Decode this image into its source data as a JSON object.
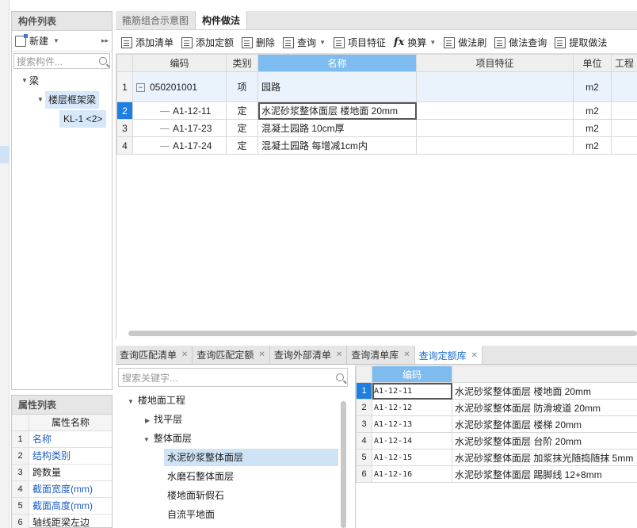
{
  "component_panel": {
    "title": "构件列表",
    "new_label": "新建",
    "search_placeholder": "搜索构件...",
    "tree": [
      "梁",
      "楼层框架梁",
      "KL-1 <2>"
    ]
  },
  "property_panel": {
    "title": "属性列表",
    "header": "属性名称",
    "rows": [
      {
        "n": "1",
        "name": "名称"
      },
      {
        "n": "2",
        "name": "结构类别"
      },
      {
        "n": "3",
        "name": "跨数量"
      },
      {
        "n": "4",
        "name": "截面宽度(mm)"
      },
      {
        "n": "5",
        "name": "截面高度(mm)"
      },
      {
        "n": "6",
        "name": "轴线距梁左边"
      }
    ]
  },
  "main_tabs": [
    "箍筋组合示意图",
    "构件做法"
  ],
  "toolbar": [
    "添加清单",
    "添加定额",
    "删除",
    "查询",
    "项目特征",
    "换算",
    "做法刷",
    "做法查询",
    "提取做法"
  ],
  "main_table": {
    "headers": [
      "编码",
      "类别",
      "名称",
      "项目特征",
      "单位",
      "工程"
    ],
    "rows": [
      {
        "n": "1",
        "code": "050201001",
        "type": "项",
        "name": "园路",
        "unit": "m2"
      },
      {
        "n": "2",
        "code": "A1-12-11",
        "type": "定",
        "name": "水泥砂浆整体面层 楼地面 20mm",
        "unit": "m2"
      },
      {
        "n": "3",
        "code": "A1-17-23",
        "type": "定",
        "name": "混凝土园路 10cm厚",
        "unit": "m2"
      },
      {
        "n": "4",
        "code": "A1-17-24",
        "type": "定",
        "name": "混凝土园路 每增减1cm内",
        "unit": "m2"
      }
    ]
  },
  "bottom_tabs": [
    "查询匹配清单",
    "查询匹配定额",
    "查询外部清单",
    "查询清单库",
    "查询定额库"
  ],
  "library": {
    "search_placeholder": "搜索关键字...",
    "tree": [
      "楼地面工程",
      "找平层",
      "整体面层",
      "水泥砂浆整体面层",
      "水磨石整体面层",
      "楼地面斩假石",
      "自流平地面"
    ],
    "code_header": "编码",
    "rows": [
      {
        "n": "1",
        "code": "A1-12-11",
        "name": "水泥砂浆整体面层 楼地面 20mm"
      },
      {
        "n": "2",
        "code": "A1-12-12",
        "name": "水泥砂浆整体面层 防滑坡道 20mm"
      },
      {
        "n": "3",
        "code": "A1-12-13",
        "name": "水泥砂浆整体面层 楼梯 20mm"
      },
      {
        "n": "4",
        "code": "A1-12-14",
        "name": "水泥砂浆整体面层 台阶 20mm"
      },
      {
        "n": "5",
        "code": "A1-12-15",
        "name": "水泥砂浆整体面层 加浆抹光随捣随抹 5mm"
      },
      {
        "n": "6",
        "code": "A1-12-16",
        "name": "水泥砂浆整体面层 踢脚线 12+8mm"
      }
    ]
  },
  "colors": {
    "accent": "#1f7fe0",
    "header_highlight": "#7ebcf0",
    "selection": "#cfe3f7"
  }
}
